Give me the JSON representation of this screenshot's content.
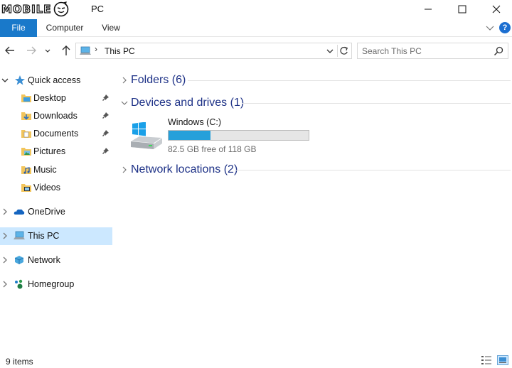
{
  "titlebar": {
    "logo_text": "MOBILE",
    "title": "PC",
    "minimize": "—",
    "maximize": "☐",
    "close": "✕"
  },
  "ribbon": {
    "tabs": [
      {
        "label": "File"
      },
      {
        "label": "Computer"
      },
      {
        "label": "View"
      }
    ],
    "help": "?"
  },
  "address_bar": {
    "path_separator": "›",
    "path": "This PC"
  },
  "search": {
    "placeholder": "Search This PC"
  },
  "nav_pane": {
    "quick_access": "Quick access",
    "pinned": [
      {
        "label": "Desktop"
      },
      {
        "label": "Downloads"
      },
      {
        "label": "Documents"
      },
      {
        "label": "Pictures"
      }
    ],
    "recent": [
      {
        "label": "Music"
      },
      {
        "label": "Videos"
      }
    ],
    "onedrive": "OneDrive",
    "this_pc": "This PC",
    "network": "Network",
    "homegroup": "Homegroup"
  },
  "content": {
    "groups": [
      {
        "label": "Folders (6)"
      },
      {
        "label": "Devices and drives (1)"
      },
      {
        "label": "Network locations (2)"
      }
    ],
    "drive": {
      "name": "Windows (C:)",
      "free_text": "82.5 GB free of 118 GB",
      "used_fraction": 0.301
    }
  },
  "status": {
    "item_count": "9 items"
  },
  "colors": {
    "accent": "#1979ca",
    "selection": "#cce8ff",
    "group_text": "#1e3287",
    "drive_fill": "#26a0da"
  }
}
